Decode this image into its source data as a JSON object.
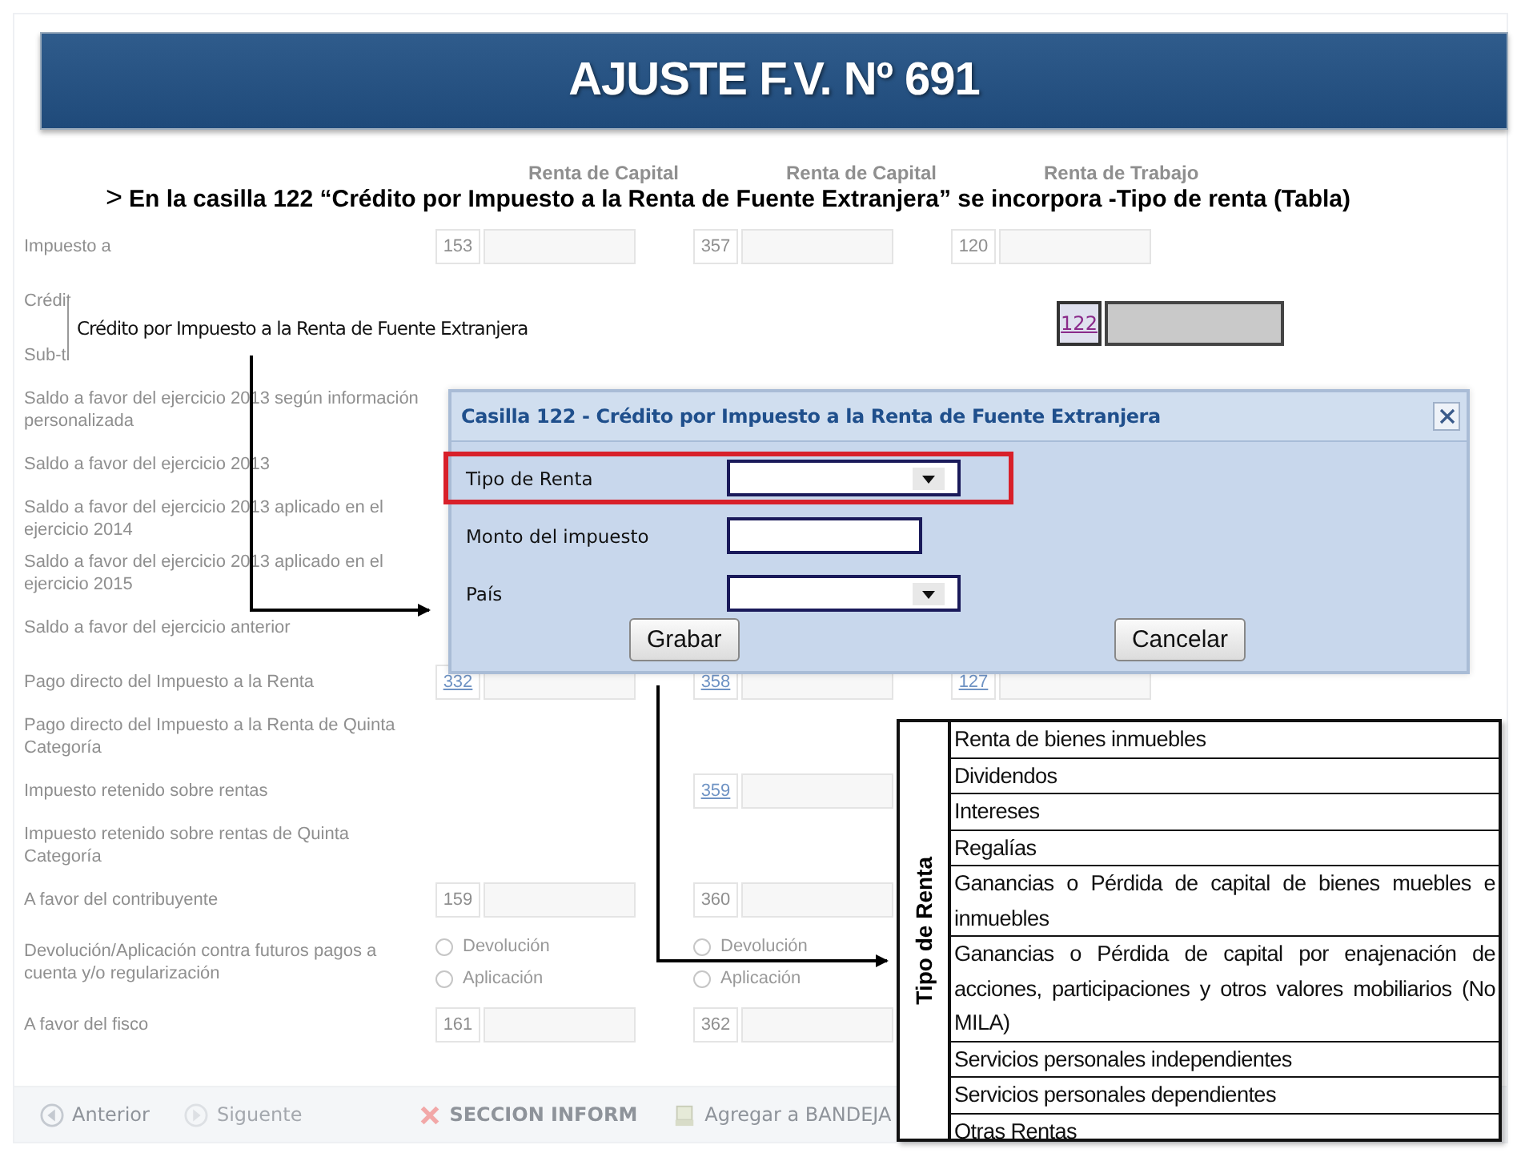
{
  "title": "AJUSTE F.V. Nº 691",
  "instruction": {
    "marker": ">",
    "text": "En la casilla 122 “Crédito por Impuesto a la Renta de Fuente Extranjera” se incorpora -Tipo de renta (Tabla)"
  },
  "form": {
    "column_headers": [
      "Renta de Capital",
      "Renta de Capital",
      "Renta de Trabajo"
    ],
    "rows": [
      {
        "label": "Impuesto a",
        "kind": "fields",
        "col_1": {
          "code": "153",
          "link": false
        },
        "col_2": {
          "code": "357",
          "link": false
        },
        "col_3": {
          "code": "120",
          "link": false
        }
      },
      {
        "label": "Crédit",
        "kind": "text"
      },
      {
        "label": "Sub-ti",
        "kind": "text"
      },
      {
        "label": "Saldo a favor del ejercicio 2013 según información personalizada",
        "kind": "text"
      },
      {
        "label": "Saldo a favor del ejercicio 2013",
        "kind": "text"
      },
      {
        "label": "Saldo a favor del ejercicio 2013 aplicado en el ejercicio 2014",
        "kind": "text"
      },
      {
        "label": "Saldo a favor del ejercicio 2013 aplicado en el ejercicio 2015",
        "kind": "text"
      },
      {
        "label": "Saldo a favor del ejercicio anterior",
        "kind": "text"
      },
      {
        "label": "Pago directo del Impuesto a la Renta",
        "kind": "fields",
        "col_1": {
          "code": "332",
          "link": true
        },
        "col_2": {
          "code": "358",
          "link": true
        },
        "col_3": {
          "code": "127",
          "link": true
        }
      },
      {
        "label": "Pago directo del Impuesto a la Renta de Quinta Categoría",
        "kind": "text"
      },
      {
        "label": "Impuesto retenido sobre rentas",
        "kind": "fields",
        "col_2": {
          "code": "359",
          "link": true
        }
      },
      {
        "label": "Impuesto retenido sobre rentas de Quinta Categoría",
        "kind": "text"
      },
      {
        "label": "A favor del contribuyente",
        "kind": "fields",
        "col_1": {
          "code": "159",
          "link": false
        },
        "col_2": {
          "code": "360",
          "link": false
        }
      },
      {
        "label": "Devolución/Aplicación contra futuros pagos a cuenta y/o regularización",
        "kind": "radios",
        "groups": [
          [
            {
              "label": "Devolución",
              "checked": false
            },
            {
              "label": "Aplicación",
              "checked": false
            }
          ],
          [
            {
              "label": "Devolución",
              "checked": false
            },
            {
              "label": "Aplicación",
              "checked": false
            }
          ]
        ]
      },
      {
        "label": "A favor del fisco",
        "kind": "fields",
        "col_1": {
          "code": "161",
          "link": false
        },
        "col_2": {
          "code": "362",
          "link": false
        }
      }
    ]
  },
  "callout": {
    "label": "Crédito por Impuesto a la Renta de Fuente Extranjera",
    "code": "122"
  },
  "dialog": {
    "title": "Casilla 122 - Crédito por Impuesto a la Renta de Fuente Extranjera",
    "fields": [
      {
        "label": "Tipo de Renta",
        "kind": "select",
        "highlighted": true
      },
      {
        "label": "Monto del impuesto",
        "kind": "text",
        "highlighted": false
      },
      {
        "label": "País",
        "kind": "select",
        "highlighted": false
      }
    ],
    "buttons": [
      "Grabar",
      "Cancelar"
    ]
  },
  "table": {
    "header": "Tipo de Renta",
    "rows": [
      "Renta de bienes inmuebles",
      "Dividendos",
      "Intereses",
      "Regalías",
      "Ganancias o Pérdida de capital de bienes muebles e inmuebles",
      "Ganancias o Pérdida de capital por enajenación de acciones, participaciones y otros valores mobiliarios (No MILA)",
      "Servicios personales independientes",
      "Servicios personales dependientes",
      "Otras Rentas"
    ]
  },
  "toolbar": [
    {
      "label": "Anterior",
      "kind": "back"
    },
    {
      "label": "Siguente",
      "kind": "forward"
    },
    {
      "label": "SECCION INFORM",
      "kind": "cross"
    },
    {
      "label": "Agregar a BANDEJA",
      "kind": "tray"
    }
  ]
}
